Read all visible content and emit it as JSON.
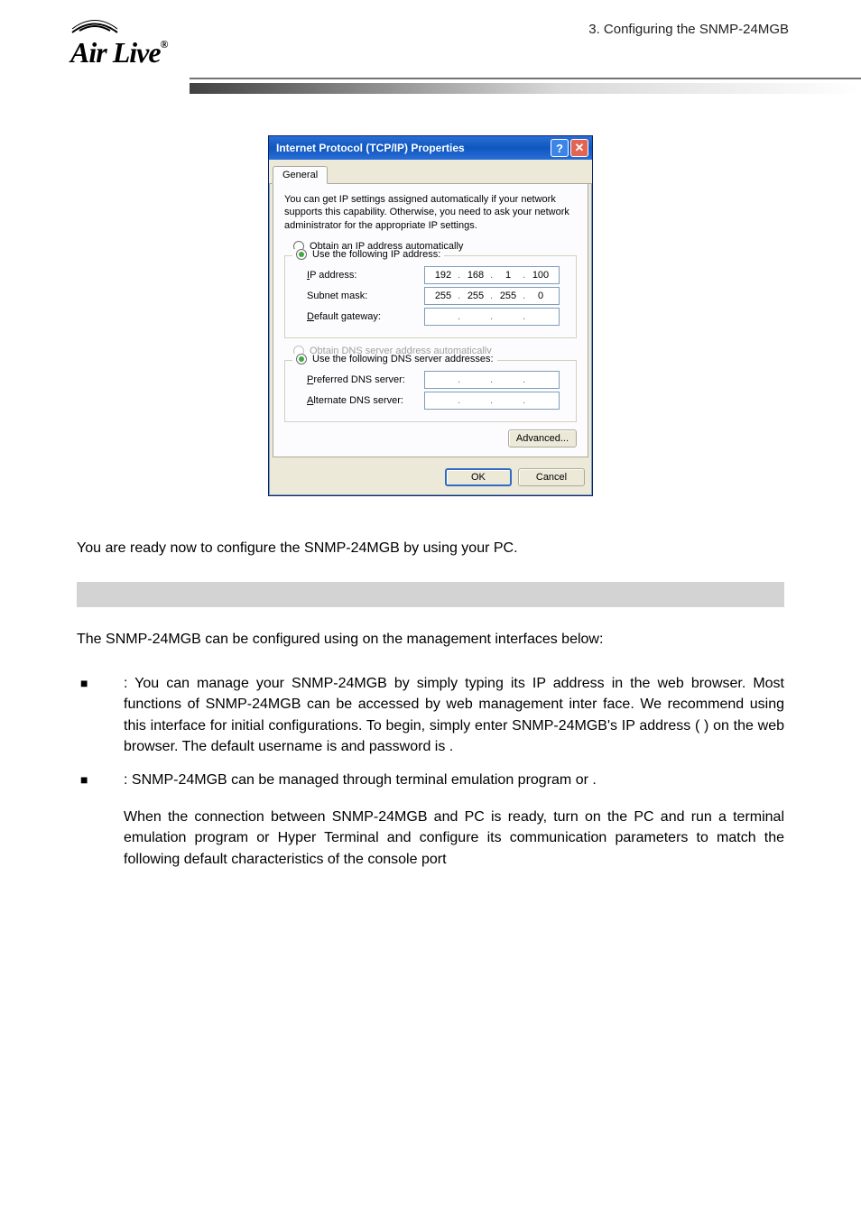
{
  "header": {
    "section_label": "3.   Configuring  the  SNMP-24MGB",
    "logo_name": "Air Live"
  },
  "dialog": {
    "title": "Internet Protocol (TCP/IP) Properties",
    "help_icon": "?",
    "close_icon": "✕",
    "tab": "General",
    "description": "You can get IP settings assigned automatically if your network supports this capability. Otherwise, you need to ask your network administrator for the appropriate IP settings.",
    "radio_auto_ip": "Obtain an IP address automatically",
    "radio_use_ip": "Use the following IP address:",
    "ip_label": "IP address:",
    "ip_value": [
      "192",
      "168",
      "1",
      "100"
    ],
    "subnet_label": "Subnet mask:",
    "subnet_value": [
      "255",
      "255",
      "255",
      "0"
    ],
    "gateway_label": "Default gateway:",
    "radio_auto_dns": "Obtain DNS server address automatically",
    "radio_use_dns": "Use the following DNS server addresses:",
    "pref_dns_label": "Preferred DNS server:",
    "alt_dns_label": "Alternate DNS server:",
    "advanced_btn": "Advanced...",
    "ok_btn": "OK",
    "cancel_btn": "Cancel"
  },
  "body": {
    "ready_text": "You are ready now to configure the SNMP-24MGB by using your PC.",
    "intro_text": "The SNMP-24MGB can be configured using on the management interfaces below:",
    "bullet1": ": You can manage your SNMP-24MGB by simply typing its IP address in the web browser. Most functions of SNMP-24MGB can be accessed by web management inter face. We recommend using this interface for initial configurations. To begin, simply enter SNMP-24MGB's IP address (                           ) on the web browser. The default username is            and password is            .",
    "bullet2_a": ": SNMP-24MGB can be managed through terminal emulation program or                          .",
    "bullet2_b": "When the connection between SNMP-24MGB and PC is ready, turn on the PC and run a terminal emulation program or Hyper Terminal and configure its communication parameters to match the following default characteristics of the console port"
  }
}
